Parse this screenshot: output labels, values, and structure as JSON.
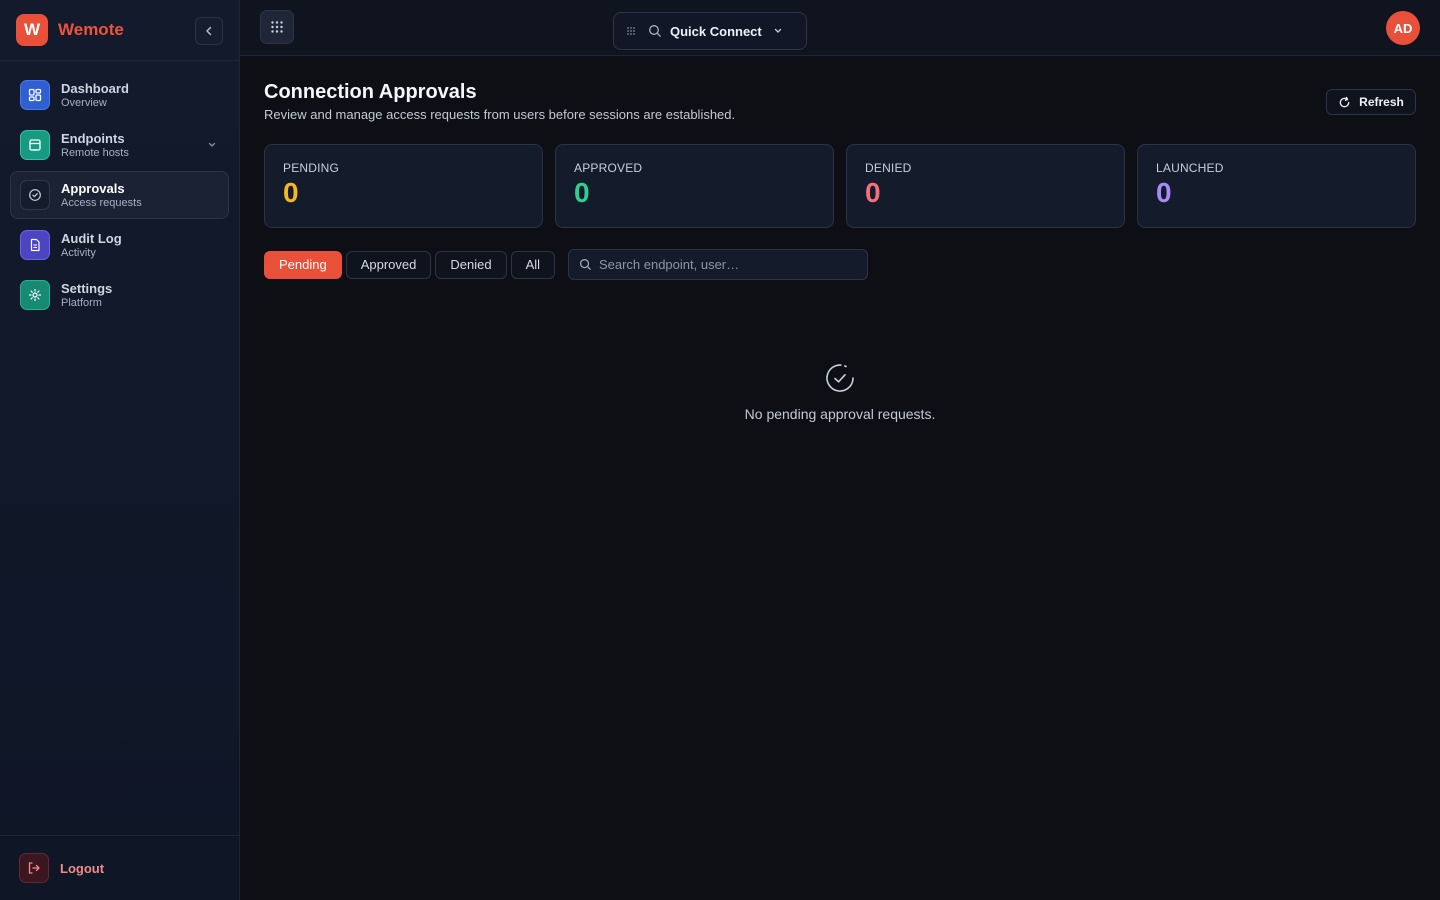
{
  "brand": {
    "logo_letter": "W",
    "name": "Wemote"
  },
  "sidebar": {
    "items": [
      {
        "label": "Dashboard",
        "sub": "Overview",
        "icon": "dashboard-icon",
        "color": "#3b6fe0"
      },
      {
        "label": "Endpoints",
        "sub": "Remote hosts",
        "icon": "server-icon",
        "color": "#1fb89a"
      },
      {
        "label": "Approvals",
        "sub": "Access requests",
        "icon": "check-circle-icon",
        "color": "#1a2233"
      },
      {
        "label": "Audit Log",
        "sub": "Activity",
        "icon": "document-icon",
        "color": "#5a52d6"
      },
      {
        "label": "Settings",
        "sub": "Platform",
        "icon": "gear-icon",
        "color": "#1a9a7e"
      }
    ],
    "logout_label": "Logout"
  },
  "topbar": {
    "quick_connect_label": "Quick Connect",
    "avatar_initials": "AD"
  },
  "page": {
    "title": "Connection Approvals",
    "subtitle": "Review and manage access requests from users before sessions are established.",
    "refresh_label": "Refresh"
  },
  "stats": [
    {
      "label": "PENDING",
      "value": "0",
      "color": "#f5b820"
    },
    {
      "label": "APPROVED",
      "value": "0",
      "color": "#2fcf8f"
    },
    {
      "label": "DENIED",
      "value": "0",
      "color": "#f2707a"
    },
    {
      "label": "LAUNCHED",
      "value": "0",
      "color": "#a78bfa"
    }
  ],
  "filters": {
    "tabs": [
      "Pending",
      "Approved",
      "Denied",
      "All"
    ],
    "search_placeholder": "Search endpoint, user…"
  },
  "empty_state": {
    "message": "No pending approval requests."
  },
  "colors": {
    "accent": "#e8503a",
    "background": "#0d0f15",
    "sidebar": "#121a2c"
  }
}
